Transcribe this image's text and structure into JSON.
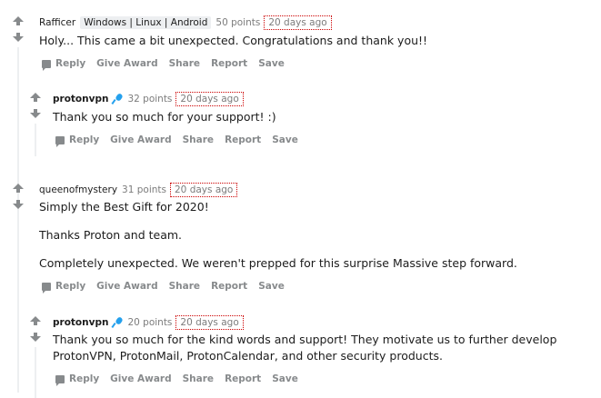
{
  "comments": [
    {
      "author": "Rafficer",
      "flair": "Windows | Linux | Android",
      "points": "50 points",
      "time": "20 days ago",
      "lines": [
        "Holy... This came a bit unexpected. Congratulations and thank you!!"
      ],
      "actions": [
        "Reply",
        "Give Award",
        "Share",
        "Report",
        "Save"
      ]
    },
    {
      "author": "protonvpn",
      "mic_icon": "microphone-icon",
      "points": "32 points",
      "time": "20 days ago",
      "lines": [
        "Thank you so much for your support! :)"
      ],
      "actions": [
        "Reply",
        "Give Award",
        "Share",
        "Report",
        "Save"
      ]
    },
    {
      "author": "queenofmystery",
      "points": "31 points",
      "time": "20 days ago",
      "lines": [
        "Simply the Best Gift for 2020!",
        "Thanks Proton and team.",
        "Completely unexpected. We weren't prepped for this surprise Massive step forward."
      ],
      "actions": [
        "Reply",
        "Give Award",
        "Share",
        "Report",
        "Save"
      ]
    },
    {
      "author": "protonvpn",
      "mic_icon": "microphone-icon",
      "points": "20 points",
      "time": "20 days ago",
      "lines": [
        "Thank you so much for the kind words and support! They motivate us to further develop",
        "ProtonVPN, ProtonMail, ProtonCalendar, and other security products."
      ],
      "actions": [
        "Reply",
        "Give Award",
        "Share",
        "Report",
        "Save"
      ]
    }
  ],
  "colors": {
    "meta_gray": "#7c7c7c",
    "action_gray": "#878a8c",
    "mic_blue": "#24a0ed",
    "thread_line": "#edeff1"
  }
}
